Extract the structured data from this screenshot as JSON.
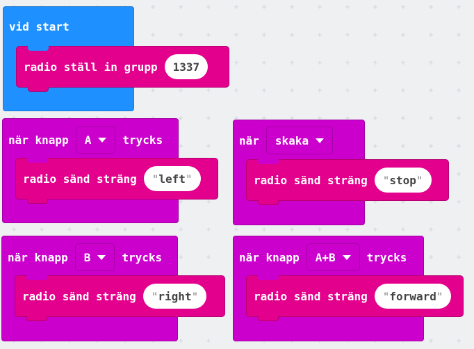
{
  "colors": {
    "start": "#1e90ff",
    "event": "#cc00cc",
    "radio": "#e3008c",
    "workspace": "#eef0f2"
  },
  "blocks": {
    "on_start": {
      "label": "vid start",
      "statement": {
        "label": "radio ställ in grupp",
        "value": "1337"
      }
    },
    "button_a": {
      "label_before": "när knapp",
      "dropdown": "A",
      "label_after": "trycks",
      "statement": {
        "label": "radio sänd sträng",
        "value": "left"
      }
    },
    "gesture": {
      "label_before": "när",
      "dropdown": "skaka",
      "statement": {
        "label": "radio sänd sträng",
        "value": "stop"
      }
    },
    "button_b": {
      "label_before": "när knapp",
      "dropdown": "B",
      "label_after": "trycks",
      "statement": {
        "label": "radio sänd sträng",
        "value": "right"
      }
    },
    "button_ab": {
      "label_before": "när knapp",
      "dropdown": "A+B",
      "label_after": "trycks",
      "statement": {
        "label": "radio sänd sträng",
        "value": "forward"
      }
    }
  }
}
